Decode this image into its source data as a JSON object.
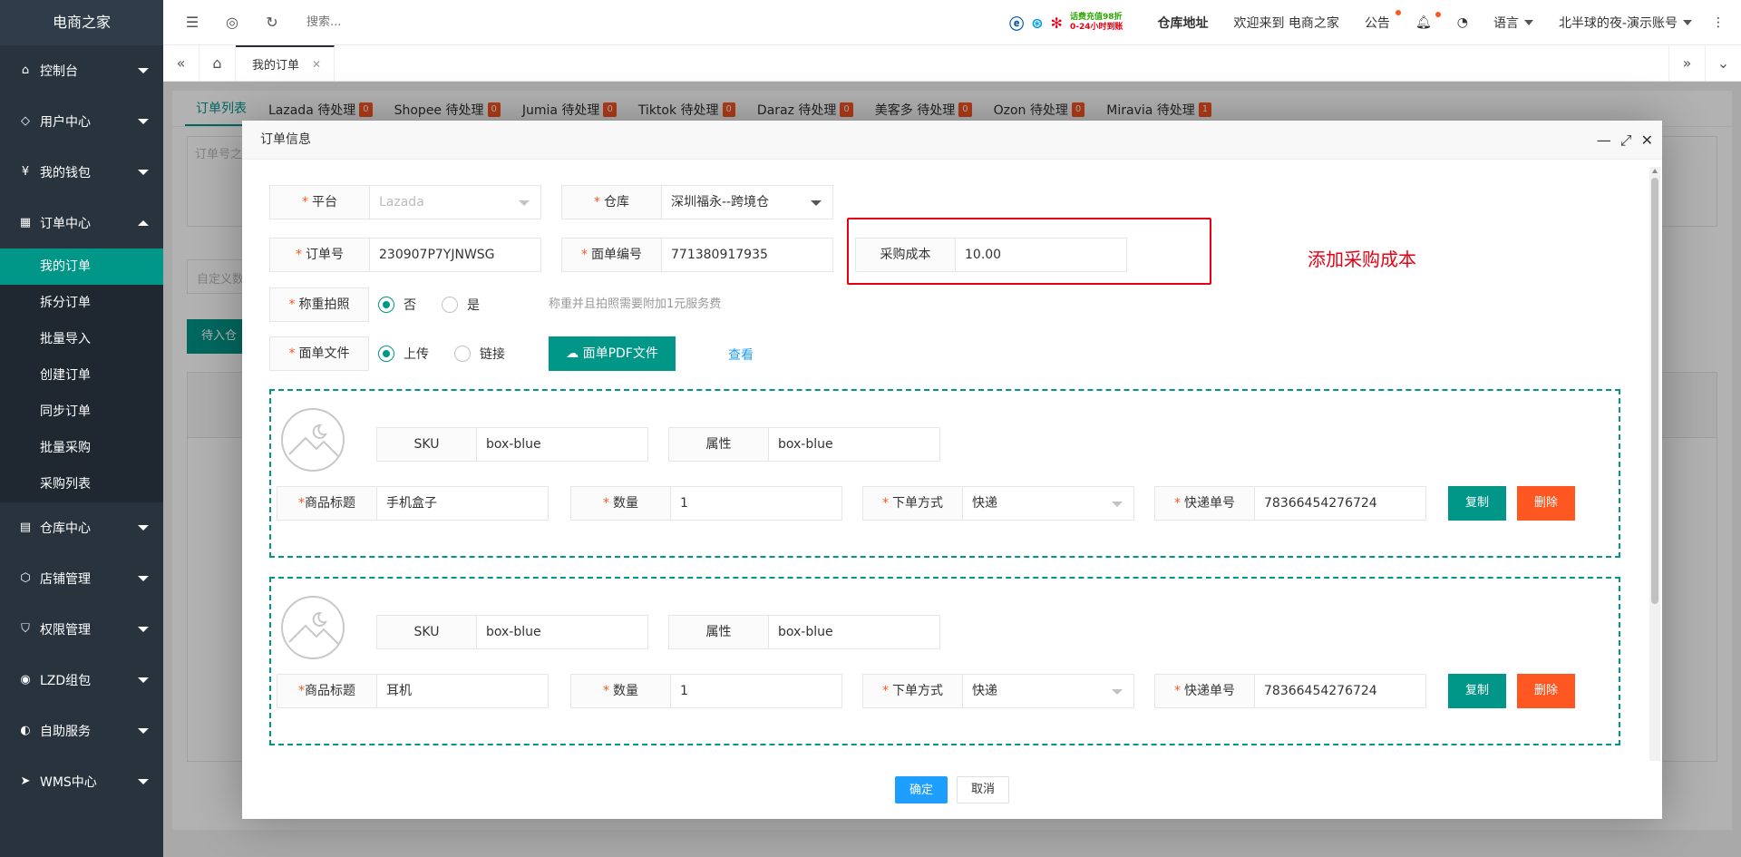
{
  "app": {
    "logo": "电商之家"
  },
  "sidebar": {
    "items": [
      {
        "label": "控制台",
        "icon": "home-icon"
      },
      {
        "label": "用户中心",
        "icon": "diamond-icon"
      },
      {
        "label": "我的钱包",
        "icon": "yen-icon"
      },
      {
        "label": "订单中心",
        "icon": "grid-icon"
      },
      {
        "label": "仓库中心",
        "icon": "warehouse-icon"
      },
      {
        "label": "店铺管理",
        "icon": "box-icon"
      },
      {
        "label": "权限管理",
        "icon": "shield-icon"
      },
      {
        "label": "LZD组包",
        "icon": "compass-icon"
      },
      {
        "label": "自助服务",
        "icon": "self-service-icon"
      },
      {
        "label": "WMS中心",
        "icon": "send-icon"
      }
    ],
    "order_sub": [
      "我的订单",
      "拆分订单",
      "批量导入",
      "创建订单",
      "同步订单",
      "批量采购",
      "采购列表"
    ]
  },
  "header": {
    "search_placeholder": "搜索...",
    "promo_line1": "话费充值98折",
    "promo_line2": "0-24小时到账",
    "warehouse_addr": "仓库地址",
    "welcome": "欢迎来到 电商之家",
    "notice": "公告",
    "language": "语言",
    "account": "北半球的夜-演示账号"
  },
  "tabs": {
    "current": "我的订单"
  },
  "background": {
    "order_tabs": [
      {
        "label": "订单列表",
        "badge": ""
      },
      {
        "label": "Lazada 待处理",
        "badge": "0"
      },
      {
        "label": "Shopee 待处理",
        "badge": "0"
      },
      {
        "label": "Jumia 待处理",
        "badge": "0"
      },
      {
        "label": "Tiktok 待处理",
        "badge": "0"
      },
      {
        "label": "Daraz 待处理",
        "badge": "0"
      },
      {
        "label": "美客多 待处理",
        "badge": "0"
      },
      {
        "label": "Ozon 待处理",
        "badge": "0"
      },
      {
        "label": "Miravia 待处理",
        "badge": "1"
      }
    ],
    "textarea_placeholder": "订单号之",
    "custom_placeholder": "自定义数",
    "pending_btn": "待入仓"
  },
  "modal": {
    "title": "订单信息",
    "platform": {
      "label": "平台",
      "value": "Lazada"
    },
    "warehouse": {
      "label": "仓库",
      "value": "深圳福永--跨境仓"
    },
    "order_no": {
      "label": "订单号",
      "value": "230907P7YJNWSG"
    },
    "waybill_no": {
      "label": "面单编号",
      "value": "771380917935"
    },
    "purchase_cost": {
      "label": "采购成本",
      "value": "10.00"
    },
    "annotation": "添加采购成本",
    "weigh_photo": {
      "label": "称重拍照",
      "no": "否",
      "yes": "是",
      "hint": "称重并且拍照需要附加1元服务费"
    },
    "waybill_file": {
      "label": "面单文件",
      "upload": "上传",
      "link": "链接",
      "pdf_btn": "面单PDF文件",
      "view": "查看"
    },
    "items": [
      {
        "sku_label": "SKU",
        "sku": "box-blue",
        "attr_label": "属性",
        "attr": "box-blue",
        "title_label": "商品标题",
        "title": "手机盒子",
        "qty_label": "数量",
        "qty": "1",
        "method_label": "下单方式",
        "method": "快递",
        "tracking_label": "快递单号",
        "tracking": "78366454276724",
        "copy": "复制",
        "delete": "删除"
      },
      {
        "sku_label": "SKU",
        "sku": "box-blue",
        "attr_label": "属性",
        "attr": "box-blue",
        "title_label": "商品标题",
        "title": "耳机",
        "qty_label": "数量",
        "qty": "1",
        "method_label": "下单方式",
        "method": "快递",
        "tracking_label": "快递单号",
        "tracking": "78366454276724",
        "copy": "复制",
        "delete": "删除"
      }
    ],
    "ok": "确定",
    "cancel": "取消"
  }
}
